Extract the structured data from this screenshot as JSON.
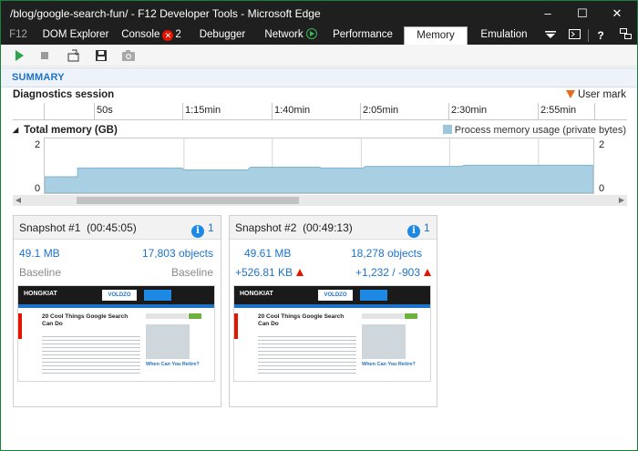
{
  "window": {
    "title": "/blog/google-search-fun/ - F12 Developer Tools - Microsoft Edge"
  },
  "tabs": {
    "f12": "F12",
    "dom": "DOM Explorer",
    "console": "Console",
    "console_badge": "2",
    "debugger": "Debugger",
    "network": "Network",
    "performance": "Performance",
    "memory": "Memory",
    "emulation": "Emulation"
  },
  "summary": {
    "label": "SUMMARY"
  },
  "diagnostics": {
    "title": "Diagnostics session",
    "user_mark": "User mark"
  },
  "timeline": {
    "ticks": [
      "50s",
      "1:15min",
      "1:40min",
      "2:05min",
      "2:30min",
      "2:55min"
    ]
  },
  "memory_chart": {
    "title": "Total memory (GB)",
    "legend": "Process memory usage (private bytes)",
    "y_top": "2",
    "y_bottom": "0",
    "y_top_right": "2",
    "y_bottom_right": "0"
  },
  "chart_data": {
    "type": "area",
    "title": "Total memory (GB)",
    "ylabel": "",
    "ylim": [
      0,
      2
    ],
    "x": [
      0,
      6,
      6.01,
      25,
      25.5,
      37,
      37.5,
      50,
      50.5,
      58,
      58.5,
      76,
      76.5,
      100
    ],
    "values": [
      0.6,
      0.6,
      0.92,
      0.92,
      0.85,
      0.85,
      0.95,
      0.95,
      0.92,
      0.92,
      0.98,
      0.98,
      1.02,
      1.02
    ],
    "series": [
      {
        "name": "Process memory usage (private bytes)",
        "color": "#a9cfe2"
      }
    ]
  },
  "snapshots": [
    {
      "name": "Snapshot #1",
      "time": "(00:45:05)",
      "info_count": "1",
      "size": "49.1 MB",
      "objects": "17,803 objects",
      "size_diff": "Baseline",
      "objects_diff": "Baseline",
      "thumb": {
        "logo": "HONGKIAT",
        "ad": "VOLDZO",
        "headline": "20 Cool Things Google Search Can Do",
        "caption": "When Can You Retire?"
      }
    },
    {
      "name": "Snapshot #2",
      "time": "(00:49:13)",
      "info_count": "1",
      "size": "49.61 MB",
      "objects": "18,278 objects",
      "size_diff": "+526.81 KB",
      "objects_diff": "+1,232 / -903",
      "thumb": {
        "logo": "HONGKIAT",
        "ad": "VOLDZO",
        "headline": "20 Cool Things Google Search Can Do",
        "caption": "When Can You Retire?"
      }
    }
  ],
  "colors": {
    "accent": "#1e73c8",
    "titlebar": "#1f1f1f",
    "increase": "#e51400",
    "area": "#a9cfe2"
  }
}
